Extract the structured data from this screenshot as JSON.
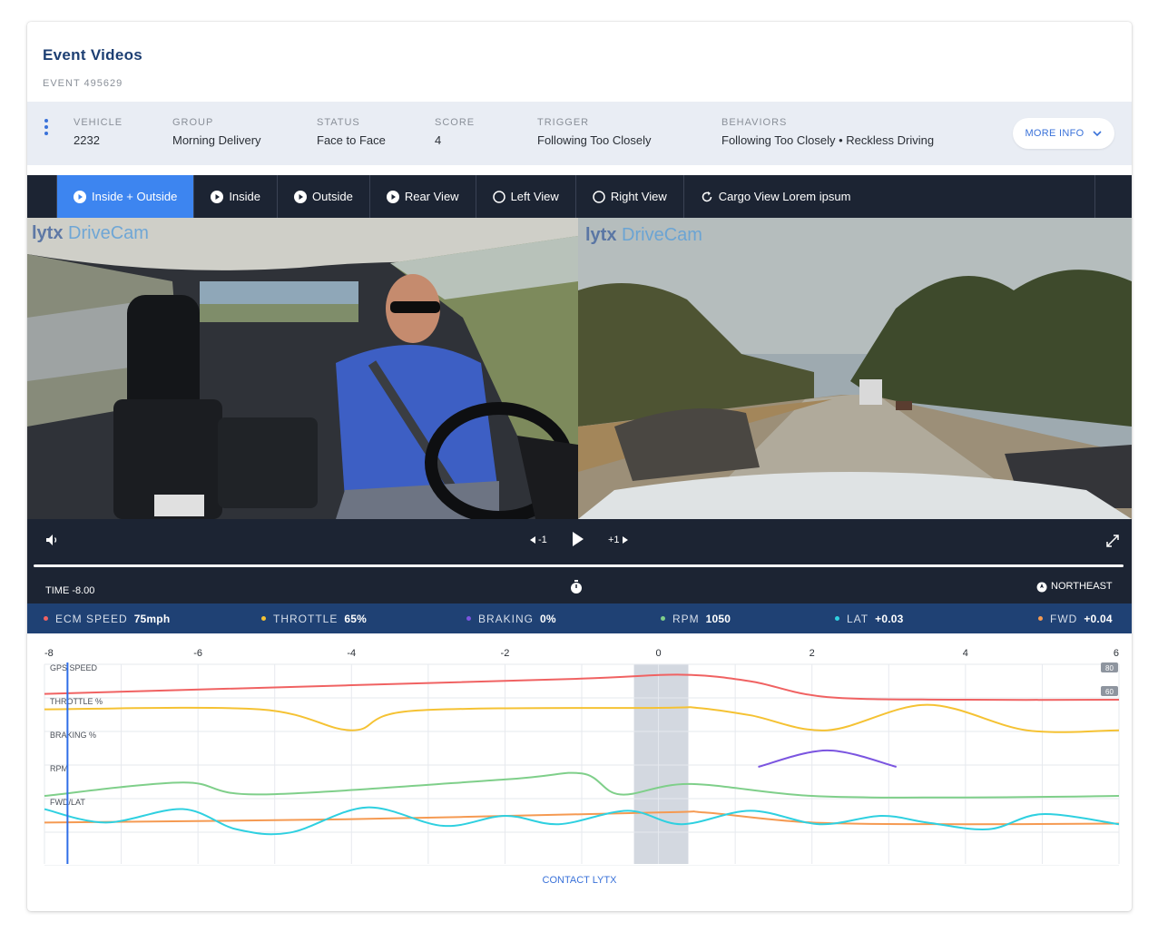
{
  "header": {
    "title": "Event Videos",
    "event_id": "EVENT 495629"
  },
  "info": {
    "vehicle": {
      "label": "VEHICLE",
      "value": "2232"
    },
    "group": {
      "label": "GROUP",
      "value": "Morning Delivery"
    },
    "status": {
      "label": "STATUS",
      "value": "Face to Face"
    },
    "score": {
      "label": "SCORE",
      "value": "4"
    },
    "trigger": {
      "label": "TRIGGER",
      "value": "Following Too Closely"
    },
    "behaviors": {
      "label": "BEHAVIORS",
      "value": "Following Too Closely • Reckless Driving"
    },
    "more_info": "MORE INFO"
  },
  "tabs": [
    {
      "label": "Inside + Outside",
      "icon": "play-circle-icon",
      "active": true
    },
    {
      "label": "Inside",
      "icon": "play-circle-icon",
      "active": false
    },
    {
      "label": "Outside",
      "icon": "play-circle-icon",
      "active": false
    },
    {
      "label": "Rear View",
      "icon": "play-circle-icon",
      "active": false
    },
    {
      "label": "Left View",
      "icon": "empty-circle-icon",
      "active": false
    },
    {
      "label": "Right View",
      "icon": "empty-circle-icon",
      "active": false
    },
    {
      "label": "Cargo View Lorem ipsum",
      "icon": "refresh-icon",
      "active": false
    }
  ],
  "video": {
    "brand_lytx": "lytx",
    "brand_drivecam": "DriveCam"
  },
  "controls": {
    "back": "-1",
    "forward": "+1"
  },
  "timebar": {
    "time_label": "TIME",
    "time_value": "-8.00",
    "heading": "NORTHEAST"
  },
  "telemetry": [
    {
      "label": "ECM SPEED",
      "value": "75mph",
      "color": "#f06262"
    },
    {
      "label": "THROTTLE",
      "value": "65%",
      "color": "#f5c233"
    },
    {
      "label": "BRAKING",
      "value": "0%",
      "color": "#7b55e0"
    },
    {
      "label": "RPM",
      "value": "1050",
      "color": "#7fcf8a"
    },
    {
      "label": "LAT",
      "value": "+0.03",
      "color": "#2fd0e0"
    },
    {
      "label": "FWD",
      "value": "+0.04",
      "color": "#f59a52"
    }
  ],
  "chart_data": {
    "type": "line",
    "x_ticks": [
      "-8",
      "-6",
      "-4",
      "-2",
      "0",
      "2",
      "4",
      "6"
    ],
    "xlim": [
      -8,
      6
    ],
    "highlight_range": [
      0,
      0.33
    ],
    "cursor_x": -7.7,
    "row_labels": [
      "GPS SPEED",
      "THROTTLE %",
      "BRAKING %",
      "RPM",
      "FWD/LAT"
    ],
    "speed_badges": [
      "80",
      "60"
    ],
    "series": [
      {
        "name": "GPS SPEED",
        "color": "#f06262",
        "band": 0,
        "points": [
          [
            -8,
            0.22
          ],
          [
            -4,
            0.55
          ],
          [
            -1,
            0.8
          ],
          [
            0.3,
            0.95
          ],
          [
            1.2,
            0.7
          ],
          [
            2.2,
            0.1
          ],
          [
            4,
            0.0
          ],
          [
            6,
            0.0
          ]
        ]
      },
      {
        "name": "THROTTLE %",
        "color": "#f5c233",
        "band": 1,
        "points": [
          [
            -8,
            0.8
          ],
          [
            -5.2,
            0.8
          ],
          [
            -4,
            0.1
          ],
          [
            -3.2,
            0.75
          ],
          [
            0,
            0.85
          ],
          [
            0.5,
            0.85
          ],
          [
            1.2,
            0.6
          ],
          [
            2.2,
            0.1
          ],
          [
            3.5,
            0.95
          ],
          [
            4.8,
            0.1
          ],
          [
            6,
            0.1
          ]
        ]
      },
      {
        "name": "BRAKING %",
        "color": "#7b55e0",
        "band": 2,
        "points": [
          [
            1.3,
            0.0
          ],
          [
            2.2,
            0.55
          ],
          [
            3.1,
            0.0
          ]
        ]
      },
      {
        "name": "RPM",
        "color": "#7fcf8a",
        "band": 3,
        "points": [
          [
            -8,
            0.15
          ],
          [
            -6.2,
            0.6
          ],
          [
            -5.2,
            0.2
          ],
          [
            -2,
            0.7
          ],
          [
            -1,
            0.9
          ],
          [
            -0.5,
            0.2
          ],
          [
            0.4,
            0.55
          ],
          [
            2,
            0.15
          ],
          [
            4,
            0.1
          ],
          [
            6,
            0.15
          ]
        ]
      },
      {
        "name": "FWD",
        "color": "#f59a52",
        "band": 4,
        "points": [
          [
            -8,
            0.45
          ],
          [
            -4,
            0.55
          ],
          [
            0,
            0.75
          ],
          [
            0.6,
            0.75
          ],
          [
            2,
            0.45
          ],
          [
            4,
            0.4
          ],
          [
            6,
            0.42
          ]
        ]
      },
      {
        "name": "LAT",
        "color": "#2fd0e0",
        "band": 4,
        "points": [
          [
            -8,
            0.85
          ],
          [
            -7.2,
            0.45
          ],
          [
            -6.2,
            0.85
          ],
          [
            -5.5,
            0.25
          ],
          [
            -4.8,
            0.15
          ],
          [
            -3.8,
            0.9
          ],
          [
            -2.8,
            0.35
          ],
          [
            -2,
            0.65
          ],
          [
            -1.3,
            0.4
          ],
          [
            -0.4,
            0.8
          ],
          [
            0.3,
            0.4
          ],
          [
            1.2,
            0.8
          ],
          [
            2.1,
            0.4
          ],
          [
            2.9,
            0.65
          ],
          [
            3.5,
            0.45
          ],
          [
            4.3,
            0.25
          ],
          [
            5,
            0.7
          ],
          [
            6,
            0.4
          ]
        ]
      }
    ]
  },
  "footer": {
    "contact": "CONTACT LYTX"
  }
}
